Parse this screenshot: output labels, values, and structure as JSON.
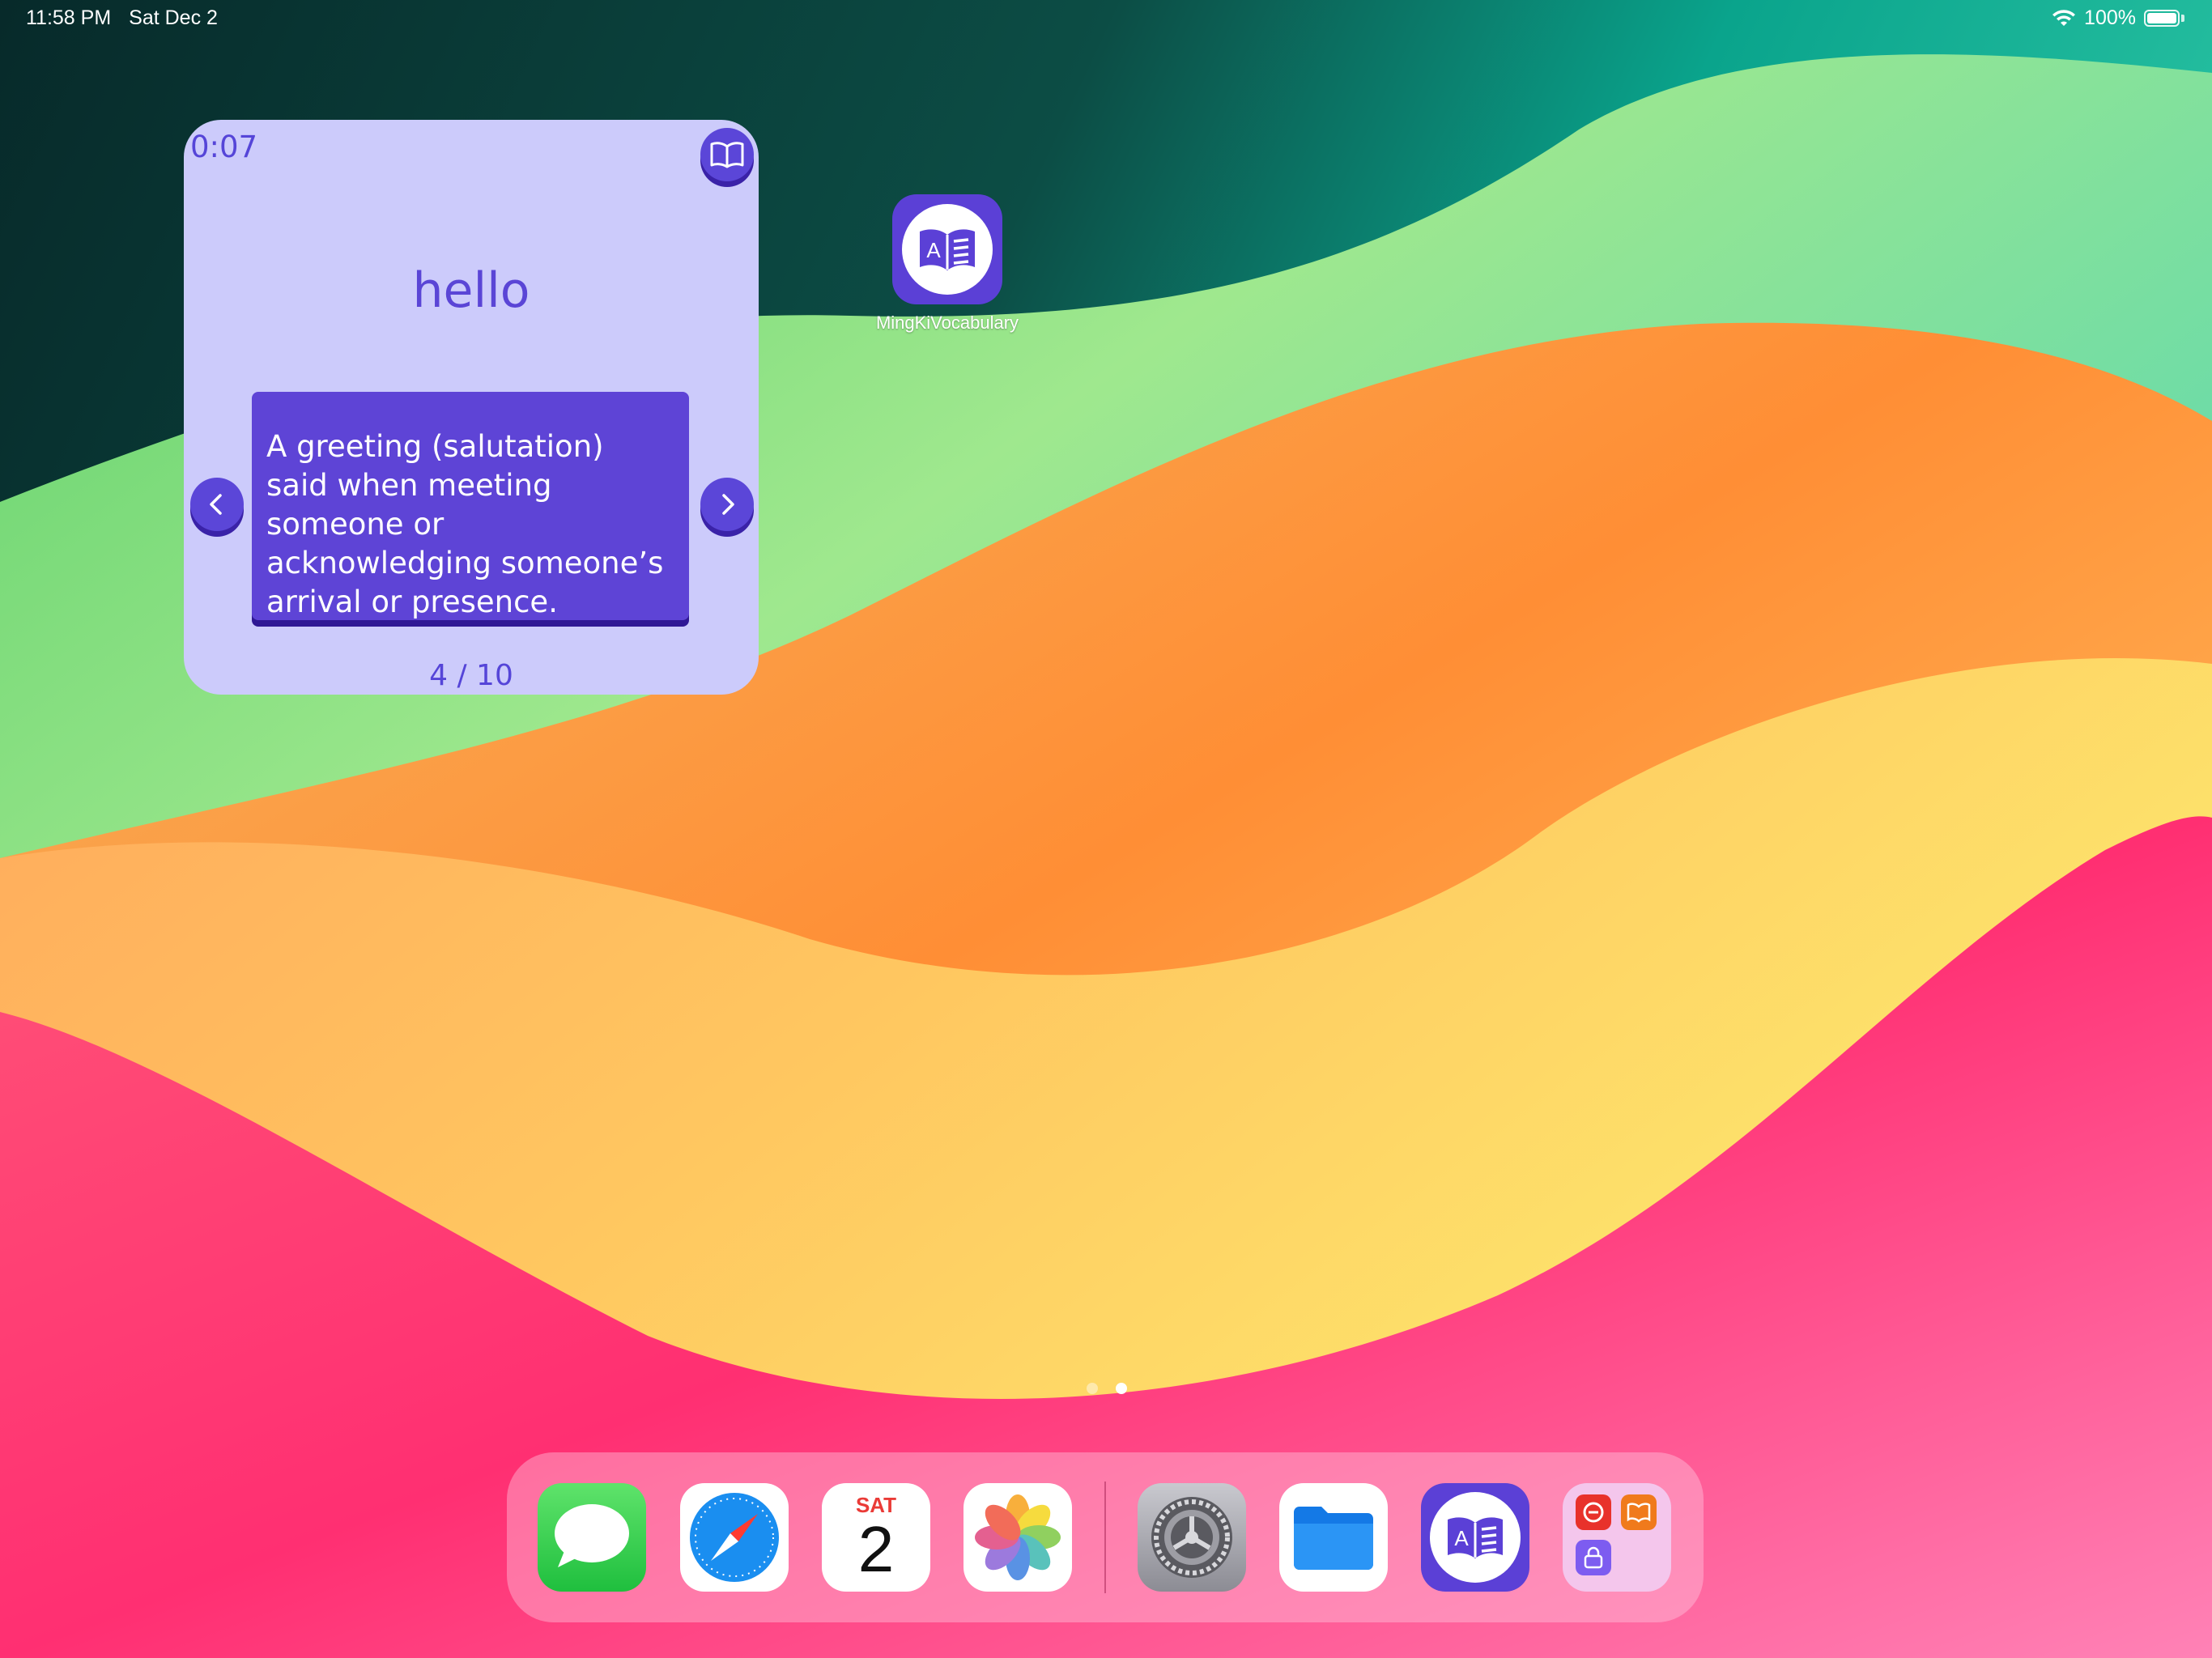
{
  "status_bar": {
    "time": "11:58 PM",
    "date": "Sat Dec 2",
    "battery": "100%",
    "wifi_icon": "wifi-icon",
    "battery_icon": "battery-icon"
  },
  "widget": {
    "timer": "0:07",
    "word": "hello",
    "definition": "A greeting (salutation) said when meeting someone or acknowledging someone’s arrival or presence.",
    "page": "4 / 10",
    "book_icon": "book-icon",
    "prev_icon": "chevron-left-icon",
    "next_icon": "chevron-right-icon",
    "colors": {
      "background": "#cccbfb",
      "accent": "#5b46d8",
      "text": "#5545d8"
    }
  },
  "home_apps": [
    {
      "label": "MingKiVocabulary",
      "icon": "vocabulary-app-icon"
    }
  ],
  "page_indicator": {
    "pages": 2,
    "current": 2
  },
  "dock": {
    "apps": [
      {
        "name": "Messages",
        "icon": "messages-icon"
      },
      {
        "name": "Safari",
        "icon": "safari-icon"
      },
      {
        "name": "Calendar",
        "icon": "calendar-icon",
        "day_label": "SAT",
        "day_number": "2"
      },
      {
        "name": "Photos",
        "icon": "photos-icon"
      },
      {
        "name": "Settings",
        "icon": "settings-icon"
      },
      {
        "name": "Files",
        "icon": "files-icon"
      },
      {
        "name": "MingKiVocabulary",
        "icon": "vocabulary-app-icon"
      },
      {
        "name": "Folder",
        "icon": "app-folder-icon"
      }
    ]
  }
}
